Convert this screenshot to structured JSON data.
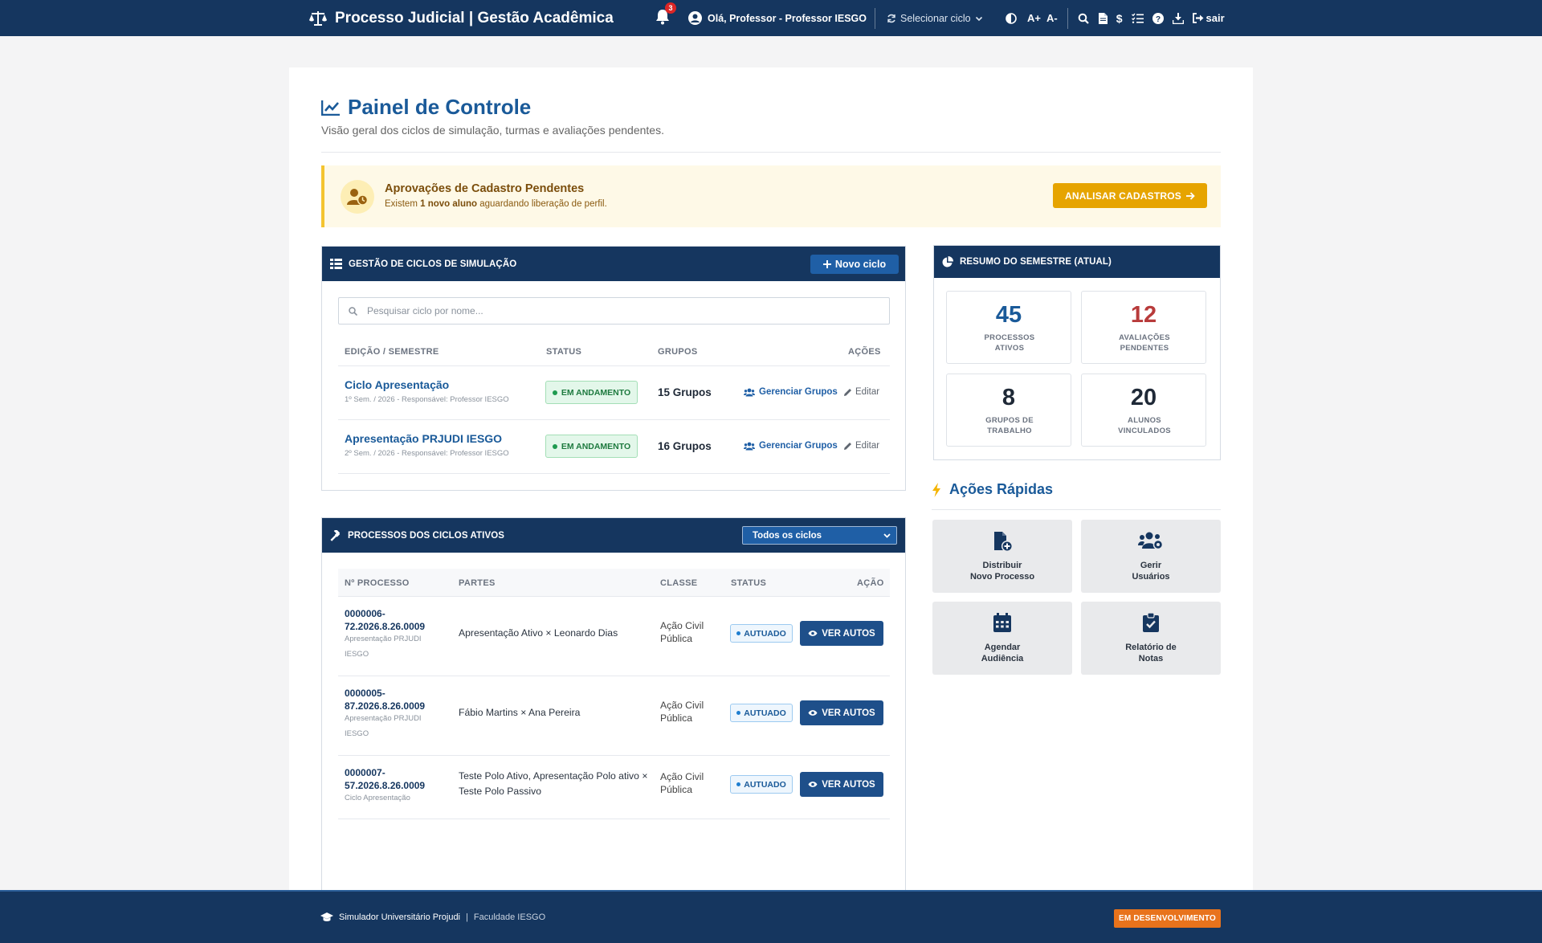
{
  "header": {
    "title": "Processo Judicial | Gestão Acadêmica",
    "notification_count": "3",
    "user_greeting": "Olá, Professor - Professor IESGO",
    "cycle_selector": "Selecionar ciclo",
    "font_increase": "A+",
    "font_decrease": "A-",
    "logout": "sair"
  },
  "page": {
    "title": "Painel de Controle",
    "subtitle": "Visão geral dos ciclos de simulação, turmas e avaliações pendentes."
  },
  "alert": {
    "title": "Aprovações de Cadastro Pendentes",
    "msg_prefix": "Existem",
    "msg_bold": "1 novo aluno",
    "msg_suffix": "aguardando liberação de perfil.",
    "button": "ANALISAR CADASTROS"
  },
  "cycles": {
    "title": "GESTÃO DE CICLOS DE SIMULAÇÃO",
    "new_button": "Novo ciclo",
    "search_placeholder": "Pesquisar ciclo por nome...",
    "columns": [
      "EDIÇÃO / SEMESTRE",
      "STATUS",
      "GRUPOS",
      "AÇÕES"
    ],
    "rows": [
      {
        "name": "Ciclo Apresentação",
        "meta": "1º Sem. / 2026 - Responsável: Professor IESGO",
        "status": "EM ANDAMENTO",
        "groups": "15 Grupos",
        "manage": "Gerenciar Grupos",
        "edit": "Editar"
      },
      {
        "name": "Apresentação PRJUDI IESGO",
        "meta": "2º Sem. / 2026 - Responsável: Professor IESGO",
        "status": "EM ANDAMENTO",
        "groups": "16 Grupos",
        "manage": "Gerenciar Grupos",
        "edit": "Editar"
      }
    ]
  },
  "processes": {
    "title": "PROCESSOS DOS CICLOS ATIVOS",
    "filter": "Todos os ciclos",
    "columns": [
      "Nº PROCESSO",
      "PARTES",
      "CLASSE",
      "STATUS",
      "AÇÃO"
    ],
    "rows": [
      {
        "number_l1": "0000006-",
        "number_l2": "72.2026.8.26.0009",
        "cycle_l1": "Apresentação PRJUDI",
        "cycle_l2": "IESGO",
        "parties_l1": "Apresentação Ativo × Leonardo Dias",
        "parties_l2": "",
        "class_l1": "Ação Civil",
        "class_l2": "Pública",
        "status": "AUTUADO",
        "action": "VER AUTOS"
      },
      {
        "number_l1": "0000005-",
        "number_l2": "87.2026.8.26.0009",
        "cycle_l1": "Apresentação PRJUDI",
        "cycle_l2": "IESGO",
        "parties_l1": "Fábio Martins × Ana Pereira",
        "parties_l2": "",
        "class_l1": "Ação Civil",
        "class_l2": "Pública",
        "status": "AUTUADO",
        "action": "VER AUTOS"
      },
      {
        "number_l1": "0000007-",
        "number_l2": "57.2026.8.26.0009",
        "cycle_l1": "Ciclo Apresentação",
        "cycle_l2": "",
        "parties_l1": "Teste Polo Ativo, Apresentação Polo ativo ×",
        "parties_l2": "Teste Polo Passivo",
        "class_l1": "Ação Civil",
        "class_l2": "Pública",
        "status": "AUTUADO",
        "action": "VER AUTOS"
      }
    ]
  },
  "summary": {
    "title": "RESUMO DO SEMESTRE (ATUAL)",
    "stats": [
      {
        "value": "45",
        "label_l1": "PROCESSOS",
        "label_l2": "ATIVOS"
      },
      {
        "value": "12",
        "label_l1": "AVALIAÇÕES",
        "label_l2": "PENDENTES"
      },
      {
        "value": "8",
        "label_l1": "GRUPOS DE",
        "label_l2": "TRABALHO"
      },
      {
        "value": "20",
        "label_l1": "ALUNOS",
        "label_l2": "VINCULADOS"
      }
    ]
  },
  "quick_actions": {
    "title": "Ações Rápidas",
    "items": [
      {
        "l1": "Distribuir",
        "l2": "Novo Processo",
        "icon": "file-plus-icon"
      },
      {
        "l1": "Gerir",
        "l2": "Usuários",
        "icon": "users-gear-icon"
      },
      {
        "l1": "Agendar",
        "l2": "Audiência",
        "icon": "calendar-icon"
      },
      {
        "l1": "Relatório de",
        "l2": "Notas",
        "icon": "clipboard-check-icon"
      }
    ]
  },
  "footer": {
    "app_name": "Simulador Universitário Projudi",
    "separator": "|",
    "institution": "Faculdade IESGO",
    "badge": "EM DESENVOLVIMENTO"
  },
  "colors": {
    "navy": "#15365f",
    "accent_blue": "#1a5a99",
    "alert_yellow": "#e6a400",
    "pending_red": "#b83b3b",
    "dev_orange": "#e8731c"
  }
}
